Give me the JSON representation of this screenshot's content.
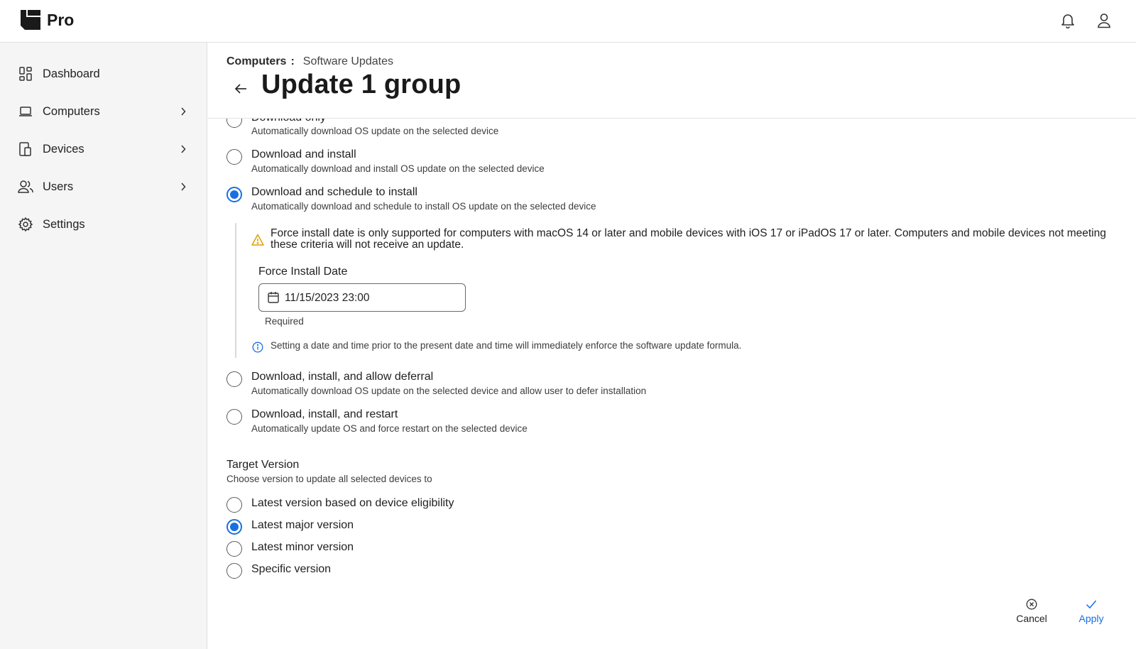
{
  "app": {
    "name": "Pro"
  },
  "topbar": {
    "icons": [
      "bell-icon",
      "user-icon"
    ]
  },
  "sidebar": {
    "items": [
      {
        "label": "Dashboard",
        "icon": "dashboard-icon",
        "has_submenu": false
      },
      {
        "label": "Computers",
        "icon": "laptop-icon",
        "has_submenu": true
      },
      {
        "label": "Devices",
        "icon": "devices-icon",
        "has_submenu": true
      },
      {
        "label": "Users",
        "icon": "users-icon",
        "has_submenu": true
      },
      {
        "label": "Settings",
        "icon": "gear-icon",
        "has_submenu": false
      }
    ]
  },
  "breadcrumb": {
    "parent": "Computers",
    "separator": ":",
    "current": "Software Updates"
  },
  "page": {
    "title": "Update 1 group"
  },
  "update_options": [
    {
      "label": "Download only",
      "description": "Automatically download OS update on the selected device",
      "selected": false
    },
    {
      "label": "Download and install",
      "description": "Automatically download and install OS update on the selected device",
      "selected": false
    },
    {
      "label": "Download and schedule to install",
      "description": "Automatically download and schedule to install OS update on the selected device",
      "selected": true
    },
    {
      "label": "Download, install, and allow deferral",
      "description": "Automatically download OS update on the selected device and allow user to defer installation",
      "selected": false
    },
    {
      "label": "Download, install, and restart",
      "description": "Automatically update OS and force restart on the selected device",
      "selected": false
    }
  ],
  "schedule": {
    "warning": "Force install date is only supported for computers with macOS 14 or later and mobile devices with iOS 17 or iPadOS 17 or later. Computers and mobile devices not meeting these criteria will not receive an update.",
    "field_label": "Force Install Date",
    "date_value": "11/15/2023 23:00",
    "required_text": "Required",
    "info": "Setting a date and time prior to the present date and time will immediately enforce the software update formula."
  },
  "target_version": {
    "title": "Target Version",
    "subtitle": "Choose version to update all selected devices to",
    "options": [
      {
        "label": "Latest version based on device eligibility",
        "selected": false
      },
      {
        "label": "Latest major version",
        "selected": true
      },
      {
        "label": "Latest minor version",
        "selected": false
      },
      {
        "label": "Specific version",
        "selected": false
      }
    ]
  },
  "footer": {
    "cancel_label": "Cancel",
    "apply_label": "Apply"
  },
  "colors": {
    "accent": "#1a6fe0",
    "warning": "#e0a100",
    "info": "#1a6fe0"
  }
}
